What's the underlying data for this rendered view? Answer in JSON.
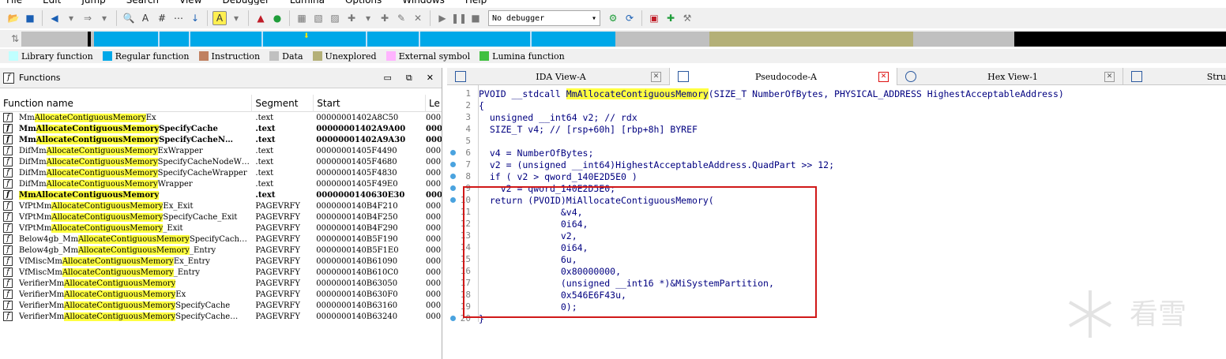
{
  "menu": [
    "File",
    "Edit",
    "Jump",
    "Search",
    "View",
    "Debugger",
    "Lumina",
    "Options",
    "Windows",
    "Help"
  ],
  "toolbar": {
    "debugger_select": "No debugger"
  },
  "legend": [
    {
      "label": "Library function",
      "color": "#c0ffff"
    },
    {
      "label": "Regular function",
      "color": "#00a8e8"
    },
    {
      "label": "Instruction",
      "color": "#c08060"
    },
    {
      "label": "Data",
      "color": "#c0c0c0"
    },
    {
      "label": "Unexplored",
      "color": "#b4b078"
    },
    {
      "label": "External symbol",
      "color": "#ffb4ff"
    },
    {
      "label": "Lumina function",
      "color": "#40c040"
    }
  ],
  "functions_panel": {
    "title": "Functions",
    "columns": [
      "Function name",
      "Segment",
      "Start",
      "Le"
    ],
    "rows": [
      {
        "pre": "Mm",
        "hl": "AllocateContiguousMemory",
        "post": "Ex",
        "seg": ".text",
        "start": "00000001402A8C50",
        "len": "000",
        "bold": false
      },
      {
        "pre": "Mm",
        "hl": "AllocateContiguousMemory",
        "post": "SpecifyCache",
        "seg": ".text",
        "start": "00000001402A9A00",
        "len": "000",
        "bold": true
      },
      {
        "pre": "Mm",
        "hl": "AllocateContiguousMemory",
        "post": "SpecifyCacheN…",
        "seg": ".text",
        "start": "00000001402A9A30",
        "len": "000",
        "bold": true
      },
      {
        "pre": "DifMm",
        "hl": "AllocateContiguousMemory",
        "post": "ExWrapper",
        "seg": ".text",
        "start": "00000001405F4490",
        "len": "000",
        "bold": false
      },
      {
        "pre": "DifMm",
        "hl": "AllocateContiguousMemory",
        "post": "SpecifyCacheNodeW…",
        "seg": ".text",
        "start": "00000001405F4680",
        "len": "000",
        "bold": false
      },
      {
        "pre": "DifMm",
        "hl": "AllocateContiguousMemory",
        "post": "SpecifyCacheWrapper",
        "seg": ".text",
        "start": "00000001405F4830",
        "len": "000",
        "bold": false
      },
      {
        "pre": "DifMm",
        "hl": "AllocateContiguousMemory",
        "post": "Wrapper",
        "seg": ".text",
        "start": "00000001405F49E0",
        "len": "000",
        "bold": false
      },
      {
        "pre": "",
        "hl": "MmAllocateContiguousMemory",
        "post": "",
        "seg": ".text",
        "start": "0000000140630E30",
        "len": "000",
        "bold": true
      },
      {
        "pre": "VfPtMm",
        "hl": "AllocateContiguousMemory",
        "post": "Ex_Exit",
        "seg": "PAGEVRFY",
        "start": "0000000140B4F210",
        "len": "000",
        "bold": false
      },
      {
        "pre": "VfPtMm",
        "hl": "AllocateContiguousMemory",
        "post": "SpecifyCache_Exit",
        "seg": "PAGEVRFY",
        "start": "0000000140B4F250",
        "len": "000",
        "bold": false
      },
      {
        "pre": "VfPtMm",
        "hl": "AllocateContiguousMemory",
        "post": "_Exit",
        "seg": "PAGEVRFY",
        "start": "0000000140B4F290",
        "len": "000",
        "bold": false
      },
      {
        "pre": "Below4gb_Mm",
        "hl": "AllocateContiguousMemory",
        "post": "SpecifyCach…",
        "seg": "PAGEVRFY",
        "start": "0000000140B5F190",
        "len": "000",
        "bold": false
      },
      {
        "pre": "Below4gb_Mm",
        "hl": "AllocateContiguousMemory",
        "post": "_Entry",
        "seg": "PAGEVRFY",
        "start": "0000000140B5F1E0",
        "len": "000",
        "bold": false
      },
      {
        "pre": "VfMiscMm",
        "hl": "AllocateContiguousMemory",
        "post": "Ex_Entry",
        "seg": "PAGEVRFY",
        "start": "0000000140B61090",
        "len": "000",
        "bold": false
      },
      {
        "pre": "VfMiscMm",
        "hl": "AllocateContiguousMemory",
        "post": "_Entry",
        "seg": "PAGEVRFY",
        "start": "0000000140B610C0",
        "len": "000",
        "bold": false
      },
      {
        "pre": "VerifierMm",
        "hl": "AllocateContiguousMemory",
        "post": "",
        "seg": "PAGEVRFY",
        "start": "0000000140B63050",
        "len": "000",
        "bold": false
      },
      {
        "pre": "VerifierMm",
        "hl": "AllocateContiguousMemory",
        "post": "Ex",
        "seg": "PAGEVRFY",
        "start": "0000000140B630F0",
        "len": "000",
        "bold": false
      },
      {
        "pre": "VerifierMm",
        "hl": "AllocateContiguousMemory",
        "post": "SpecifyCache",
        "seg": "PAGEVRFY",
        "start": "0000000140B63160",
        "len": "000",
        "bold": false
      },
      {
        "pre": "VerifierMm",
        "hl": "AllocateContiguousMemory",
        "post": "SpecifyCache…",
        "seg": "PAGEVRFY",
        "start": "0000000140B63240",
        "len": "000",
        "bold": false
      }
    ]
  },
  "tabs": [
    {
      "label": "IDA View-A"
    },
    {
      "label": "Pseudocode-A"
    },
    {
      "label": "Hex View-1"
    },
    {
      "label": "Stru"
    }
  ],
  "code": {
    "lines": [
      {
        "n": "1",
        "t": "PVOID __stdcall MmAllocateContiguousMemory(SIZE_T NumberOfBytes, PHYSICAL_ADDRESS HighestAcceptableAddress)",
        "dot": false
      },
      {
        "n": "2",
        "t": "{",
        "dot": false
      },
      {
        "n": "3",
        "t": "  unsigned __int64 v2; // rdx",
        "dot": false
      },
      {
        "n": "4",
        "t": "  SIZE_T v4; // [rsp+60h] [rbp+8h] BYREF",
        "dot": false
      },
      {
        "n": "5",
        "t": "",
        "dot": false
      },
      {
        "n": "6",
        "t": "  v4 = NumberOfBytes;",
        "dot": true
      },
      {
        "n": "7",
        "t": "  v2 = (unsigned __int64)HighestAcceptableAddress.QuadPart >> 12;",
        "dot": true
      },
      {
        "n": "8",
        "t": "  if ( v2 > qword_140E2D5E0 )",
        "dot": true
      },
      {
        "n": "9",
        "t": "    v2 = qword_140E2D5E0;",
        "dot": true
      },
      {
        "n": "10",
        "t": "  return (PVOID)MiAllocateContiguousMemory(",
        "dot": true
      },
      {
        "n": "11",
        "t": "               &v4,",
        "dot": false
      },
      {
        "n": "12",
        "t": "               0i64,",
        "dot": false
      },
      {
        "n": "13",
        "t": "               v2,",
        "dot": false
      },
      {
        "n": "14",
        "t": "               0i64,",
        "dot": false
      },
      {
        "n": "15",
        "t": "               6u,",
        "dot": false
      },
      {
        "n": "16",
        "t": "               0x80000000,",
        "dot": false
      },
      {
        "n": "17",
        "t": "               (unsigned __int16 *)&MiSystemPartition,",
        "dot": false
      },
      {
        "n": "18",
        "t": "               0x546E6F43u,",
        "dot": false
      },
      {
        "n": "19",
        "t": "               0);",
        "dot": false
      },
      {
        "n": "20",
        "t": "}",
        "dot": true
      }
    ]
  },
  "watermark": "看雪"
}
